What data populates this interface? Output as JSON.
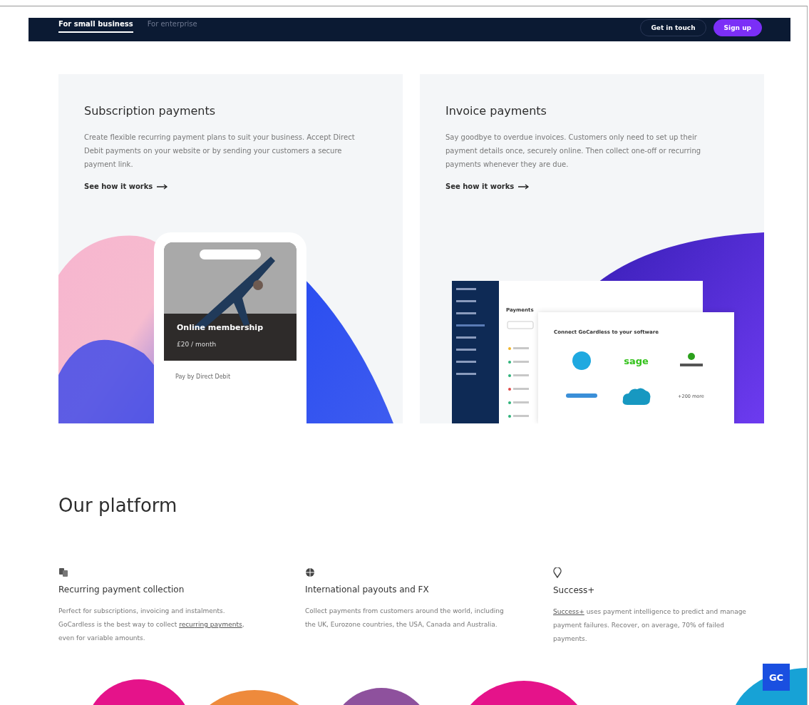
{
  "nav": {
    "tabs": [
      {
        "label": "For small business",
        "selected": true
      },
      {
        "label": "For enterprise",
        "selected": false
      }
    ],
    "buttons": [
      {
        "label": "Get in touch",
        "kind": "outline"
      },
      {
        "label": "Sign up",
        "kind": "primary"
      }
    ]
  },
  "cards": [
    {
      "kind": "subscription",
      "title": "Subscription payments",
      "description": "Create flexible recurring payment plans to suit your business. Accept Direct Debit payments on your website or by sending your customers a secure payment link.",
      "link": "See how it works",
      "phone": {
        "title": "Online membership",
        "price": "£20 / month",
        "footer": "Pay by Direct Debit"
      }
    },
    {
      "kind": "invoice",
      "title": "Invoice payments",
      "description": "Say goodbye to overdue invoices. Customers only need to set up their payment details once, securely online. Then collect one-off or recurring payments whenever they are due.",
      "link": "See how it works",
      "app": {
        "panel_title": "Payments",
        "connect_title": "Connect GoCardless to your software",
        "logo_text": "sage",
        "more": "+200 more"
      }
    }
  ],
  "platform": {
    "heading": "Our platform",
    "features": [
      {
        "kind": "coins",
        "title": "Recurring payment collection",
        "before": "Perfect for subscriptions, invoicing and instalments. GoCardless is the best way to collect ",
        "link": "recurring payments",
        "after": ", even for variable amounts."
      },
      {
        "kind": "globe",
        "title": "International payouts and FX",
        "before": "Collect payments from customers around the world, including the UK, Eurozone countries, the USA, Canada and Australia."
      },
      {
        "kind": "pin",
        "title": "Success+",
        "link": "Success+",
        "after": " uses payment intelligence to predict and manage payment failures. Recover, on average, 70% of failed payments."
      }
    ]
  },
  "badge": "GC"
}
